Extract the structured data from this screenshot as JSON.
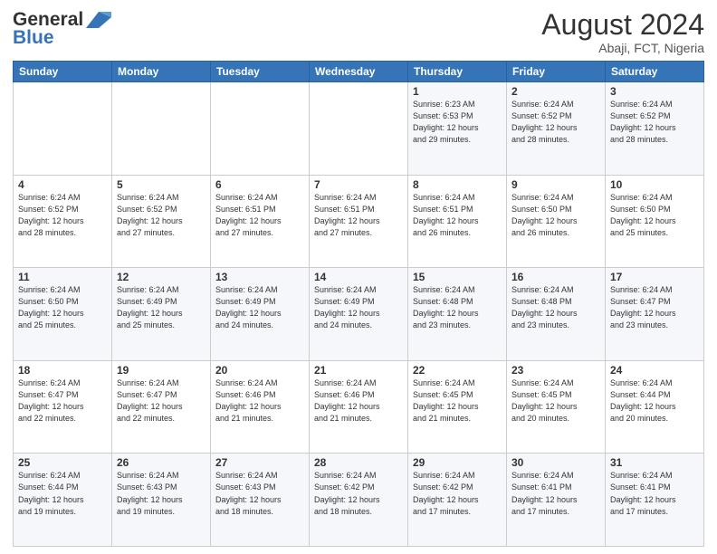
{
  "header": {
    "logo_line1": "General",
    "logo_line2": "Blue",
    "month_year": "August 2024",
    "location": "Abaji, FCT, Nigeria"
  },
  "days_of_week": [
    "Sunday",
    "Monday",
    "Tuesday",
    "Wednesday",
    "Thursday",
    "Friday",
    "Saturday"
  ],
  "weeks": [
    [
      {
        "day": "",
        "info": ""
      },
      {
        "day": "",
        "info": ""
      },
      {
        "day": "",
        "info": ""
      },
      {
        "day": "",
        "info": ""
      },
      {
        "day": "1",
        "info": "Sunrise: 6:23 AM\nSunset: 6:53 PM\nDaylight: 12 hours\nand 29 minutes."
      },
      {
        "day": "2",
        "info": "Sunrise: 6:24 AM\nSunset: 6:52 PM\nDaylight: 12 hours\nand 28 minutes."
      },
      {
        "day": "3",
        "info": "Sunrise: 6:24 AM\nSunset: 6:52 PM\nDaylight: 12 hours\nand 28 minutes."
      }
    ],
    [
      {
        "day": "4",
        "info": "Sunrise: 6:24 AM\nSunset: 6:52 PM\nDaylight: 12 hours\nand 28 minutes."
      },
      {
        "day": "5",
        "info": "Sunrise: 6:24 AM\nSunset: 6:52 PM\nDaylight: 12 hours\nand 27 minutes."
      },
      {
        "day": "6",
        "info": "Sunrise: 6:24 AM\nSunset: 6:51 PM\nDaylight: 12 hours\nand 27 minutes."
      },
      {
        "day": "7",
        "info": "Sunrise: 6:24 AM\nSunset: 6:51 PM\nDaylight: 12 hours\nand 27 minutes."
      },
      {
        "day": "8",
        "info": "Sunrise: 6:24 AM\nSunset: 6:51 PM\nDaylight: 12 hours\nand 26 minutes."
      },
      {
        "day": "9",
        "info": "Sunrise: 6:24 AM\nSunset: 6:50 PM\nDaylight: 12 hours\nand 26 minutes."
      },
      {
        "day": "10",
        "info": "Sunrise: 6:24 AM\nSunset: 6:50 PM\nDaylight: 12 hours\nand 25 minutes."
      }
    ],
    [
      {
        "day": "11",
        "info": "Sunrise: 6:24 AM\nSunset: 6:50 PM\nDaylight: 12 hours\nand 25 minutes."
      },
      {
        "day": "12",
        "info": "Sunrise: 6:24 AM\nSunset: 6:49 PM\nDaylight: 12 hours\nand 25 minutes."
      },
      {
        "day": "13",
        "info": "Sunrise: 6:24 AM\nSunset: 6:49 PM\nDaylight: 12 hours\nand 24 minutes."
      },
      {
        "day": "14",
        "info": "Sunrise: 6:24 AM\nSunset: 6:49 PM\nDaylight: 12 hours\nand 24 minutes."
      },
      {
        "day": "15",
        "info": "Sunrise: 6:24 AM\nSunset: 6:48 PM\nDaylight: 12 hours\nand 23 minutes."
      },
      {
        "day": "16",
        "info": "Sunrise: 6:24 AM\nSunset: 6:48 PM\nDaylight: 12 hours\nand 23 minutes."
      },
      {
        "day": "17",
        "info": "Sunrise: 6:24 AM\nSunset: 6:47 PM\nDaylight: 12 hours\nand 23 minutes."
      }
    ],
    [
      {
        "day": "18",
        "info": "Sunrise: 6:24 AM\nSunset: 6:47 PM\nDaylight: 12 hours\nand 22 minutes."
      },
      {
        "day": "19",
        "info": "Sunrise: 6:24 AM\nSunset: 6:47 PM\nDaylight: 12 hours\nand 22 minutes."
      },
      {
        "day": "20",
        "info": "Sunrise: 6:24 AM\nSunset: 6:46 PM\nDaylight: 12 hours\nand 21 minutes."
      },
      {
        "day": "21",
        "info": "Sunrise: 6:24 AM\nSunset: 6:46 PM\nDaylight: 12 hours\nand 21 minutes."
      },
      {
        "day": "22",
        "info": "Sunrise: 6:24 AM\nSunset: 6:45 PM\nDaylight: 12 hours\nand 21 minutes."
      },
      {
        "day": "23",
        "info": "Sunrise: 6:24 AM\nSunset: 6:45 PM\nDaylight: 12 hours\nand 20 minutes."
      },
      {
        "day": "24",
        "info": "Sunrise: 6:24 AM\nSunset: 6:44 PM\nDaylight: 12 hours\nand 20 minutes."
      }
    ],
    [
      {
        "day": "25",
        "info": "Sunrise: 6:24 AM\nSunset: 6:44 PM\nDaylight: 12 hours\nand 19 minutes."
      },
      {
        "day": "26",
        "info": "Sunrise: 6:24 AM\nSunset: 6:43 PM\nDaylight: 12 hours\nand 19 minutes."
      },
      {
        "day": "27",
        "info": "Sunrise: 6:24 AM\nSunset: 6:43 PM\nDaylight: 12 hours\nand 18 minutes."
      },
      {
        "day": "28",
        "info": "Sunrise: 6:24 AM\nSunset: 6:42 PM\nDaylight: 12 hours\nand 18 minutes."
      },
      {
        "day": "29",
        "info": "Sunrise: 6:24 AM\nSunset: 6:42 PM\nDaylight: 12 hours\nand 17 minutes."
      },
      {
        "day": "30",
        "info": "Sunrise: 6:24 AM\nSunset: 6:41 PM\nDaylight: 12 hours\nand 17 minutes."
      },
      {
        "day": "31",
        "info": "Sunrise: 6:24 AM\nSunset: 6:41 PM\nDaylight: 12 hours\nand 17 minutes."
      }
    ]
  ]
}
